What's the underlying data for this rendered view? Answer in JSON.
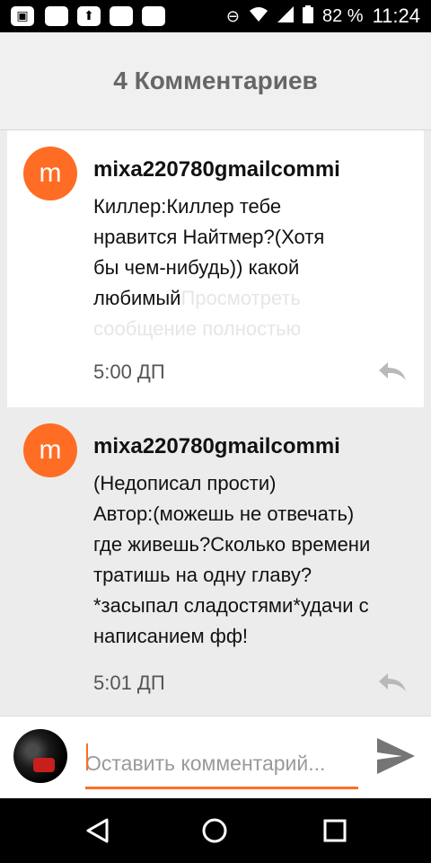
{
  "status_bar": {
    "battery_percent": "82 %",
    "time": "11:24"
  },
  "header": {
    "title": "4 Комментариев"
  },
  "comments": [
    {
      "avatar_letter": "m",
      "author": "mixa220780gmailcommi",
      "text_lines": [
        "Киллер:Киллер тебе",
        "нравится Найтмер?(Хотя",
        "бы чем-нибудь)) какой",
        "любимый"
      ],
      "more_text": "Просмотреть",
      "more_text_line2": "сообщение полностью",
      "time": "5:00 ДП"
    },
    {
      "avatar_letter": "m",
      "author": "mixa220780gmailcommi",
      "text_lines": [
        "(Недописал прости)",
        "Автор:(можешь не отвечать)",
        "где живешь?Сколько времени",
        "тратишь на одну главу?",
        "*засыпал сладостями*удачи с",
        "написанием фф!"
      ],
      "time": "5:01 ДП"
    }
  ],
  "composer": {
    "placeholder": "Оставить комментарий..."
  },
  "colors": {
    "accent": "#ff6d24",
    "background": "#ececec"
  },
  "icons": {
    "reply": "reply-icon",
    "send": "send-icon",
    "nav_back": "back-icon",
    "nav_home": "home-icon",
    "nav_recents": "recents-icon"
  }
}
